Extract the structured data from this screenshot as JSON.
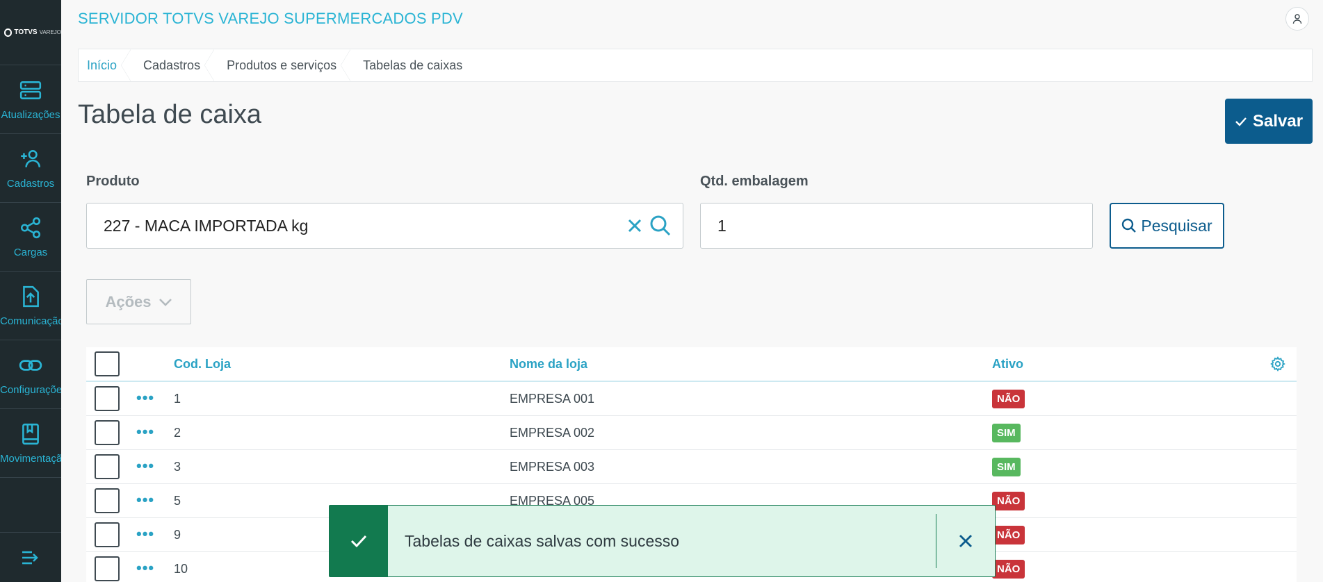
{
  "brand": {
    "name": "TOTVS",
    "sub": "VAREJO"
  },
  "sidebar": {
    "items": [
      {
        "label": "Atualizações",
        "icon": "server-icon"
      },
      {
        "label": "Cadastros",
        "icon": "add-user-icon"
      },
      {
        "label": "Cargas",
        "icon": "share-icon"
      },
      {
        "label": "Comunicação",
        "icon": "upload-file-icon"
      },
      {
        "label": "Configurações",
        "icon": "link-icon"
      },
      {
        "label": "Movimentação",
        "icon": "book-icon"
      }
    ]
  },
  "header": {
    "title": "SERVIDOR TOTVS VAREJO SUPERMERCADOS PDV"
  },
  "breadcrumb": [
    "Início",
    "Cadastros",
    "Produtos e serviços",
    "Tabelas de caixas"
  ],
  "page": {
    "title": "Tabela de caixa",
    "save_label": "Salvar"
  },
  "form": {
    "produto_label": "Produto",
    "produto_value": "227 - MACA IMPORTADA kg",
    "qtd_label": "Qtd. embalagem",
    "qtd_value": "1",
    "search_label": "Pesquisar"
  },
  "actions_label": "Ações",
  "table": {
    "columns": [
      "Cod. Loja",
      "Nome da loja",
      "Ativo"
    ],
    "rows": [
      {
        "cod": "1",
        "nome": "EMPRESA 001",
        "ativo": "NÃO"
      },
      {
        "cod": "2",
        "nome": "EMPRESA 002",
        "ativo": "SIM"
      },
      {
        "cod": "3",
        "nome": "EMPRESA 003",
        "ativo": "SIM"
      },
      {
        "cod": "5",
        "nome": "EMPRESA 005",
        "ativo": "NÃO"
      },
      {
        "cod": "9",
        "nome": "",
        "ativo": "NÃO"
      },
      {
        "cod": "10",
        "nome": "",
        "ativo": "NÃO"
      }
    ]
  },
  "toast": {
    "message": "Tabelas de caixas salvas com sucesso"
  },
  "colors": {
    "accent": "#2ab4d4",
    "primary": "#0c5c8d",
    "success": "#127a4f",
    "danger": "#c9343a",
    "ok": "#58b85f",
    "sidebar": "#1f2a2e"
  }
}
